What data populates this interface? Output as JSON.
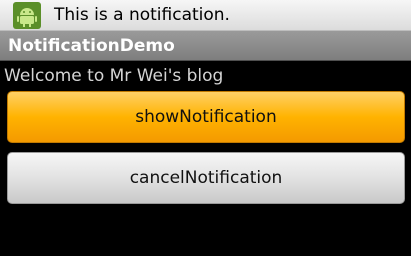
{
  "status_bar": {
    "notification_icon": "android-robot-icon",
    "notification_text": "This is a notification."
  },
  "title_bar": {
    "title": "NotificationDemo"
  },
  "content": {
    "welcome_text": "Welcome to Mr Wei's blog",
    "show_button_label": "showNotification",
    "cancel_button_label": "cancelNotification"
  },
  "colors": {
    "show_button": "#ffb300",
    "cancel_button": "#e2e2e2",
    "background": "#000000"
  }
}
